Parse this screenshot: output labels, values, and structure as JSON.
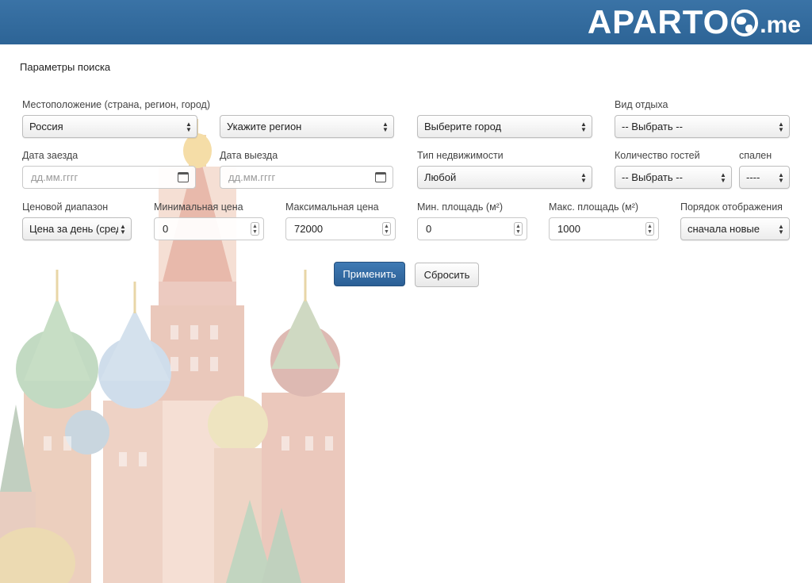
{
  "brand": {
    "name": "APARTO",
    "tld": ".me"
  },
  "page": {
    "section_title": "Параметры поиска"
  },
  "labels": {
    "location": "Местоположение (страна, регион, город)",
    "vacation_type": "Вид отдыха",
    "checkin": "Дата заезда",
    "checkout": "Дата выезда",
    "property_type": "Тип недвижимости",
    "guests": "Количество гостей",
    "bedrooms": "спален",
    "price_range": "Ценовой диапазон",
    "min_price": "Минимальная цена",
    "max_price": "Максимальная цена",
    "min_area": "Мин. площадь (м²)",
    "max_area": "Макс. площадь (м²)",
    "sort_order": "Порядок отображения"
  },
  "fields": {
    "country": "Россия",
    "region": "Укажите регион",
    "city": "Выберите город",
    "vacation_type": "-- Выбрать --",
    "checkin_placeholder": "дд.мм.гггг",
    "checkout_placeholder": "дд.мм.гггг",
    "property_type": "Любой",
    "guests": "-- Выбрать --",
    "bedrooms": "----",
    "price_range": "Цена за день (сред",
    "min_price": "0",
    "max_price": "72000",
    "min_area": "0",
    "max_area": "1000",
    "sort_order": "сначала новые"
  },
  "buttons": {
    "apply": "Применить",
    "reset": "Сбросить"
  },
  "icons": {
    "select": "select-arrows-icon",
    "calendar": "calendar-icon",
    "spinner": "number-spinner-icon",
    "globe": "globe-icon"
  },
  "colors": {
    "header": "#2f6699",
    "primary_button": "#336ea8",
    "text": "#333333"
  }
}
